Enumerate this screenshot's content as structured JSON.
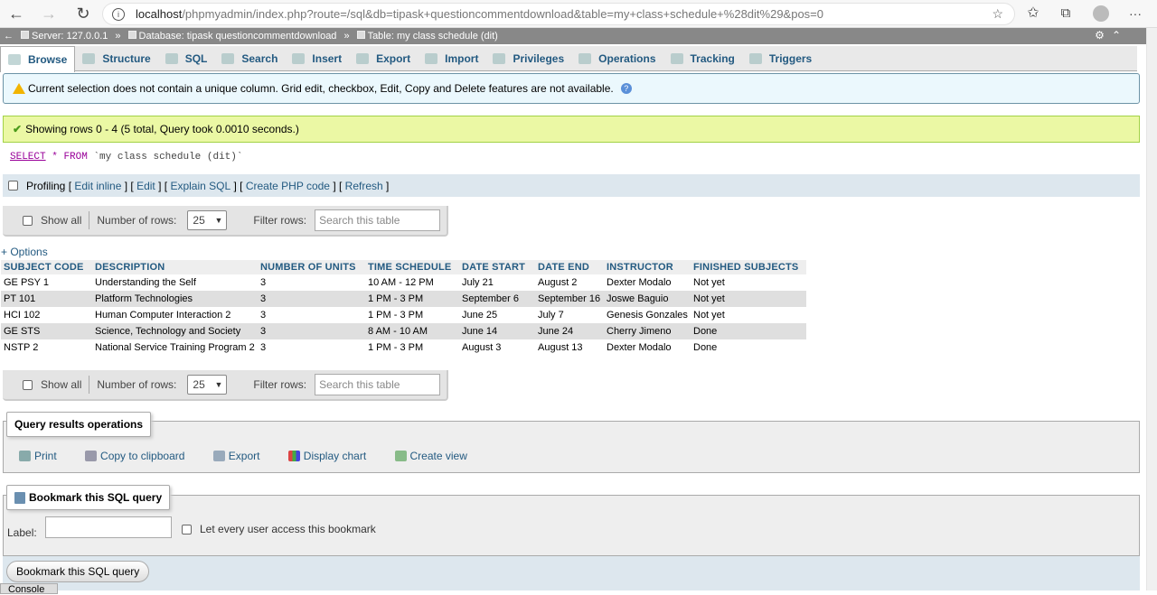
{
  "browser": {
    "url_host": "localhost",
    "url_rest": "/phpmyadmin/index.php?route=/sql&db=tipask+questioncommentdownload&table=my+class+schedule+%28dit%29&pos=0"
  },
  "breadcrumb": {
    "server": "Server: 127.0.0.1",
    "database": "Database: tipask questioncommentdownload",
    "table": "Table: my class schedule (dit)"
  },
  "tabs": [
    {
      "label": "Browse",
      "icon": "browse-icon"
    },
    {
      "label": "Structure",
      "icon": "structure-icon"
    },
    {
      "label": "SQL",
      "icon": "sql-icon"
    },
    {
      "label": "Search",
      "icon": "search-icon"
    },
    {
      "label": "Insert",
      "icon": "insert-icon"
    },
    {
      "label": "Export",
      "icon": "export-icon"
    },
    {
      "label": "Import",
      "icon": "import-icon"
    },
    {
      "label": "Privileges",
      "icon": "privileges-icon"
    },
    {
      "label": "Operations",
      "icon": "operations-icon"
    },
    {
      "label": "Tracking",
      "icon": "tracking-icon"
    },
    {
      "label": "Triggers",
      "icon": "triggers-icon"
    }
  ],
  "notice": "Current selection does not contain a unique column. Grid edit, checkbox, Edit, Copy and Delete features are not available.",
  "success": "Showing rows 0 - 4 (5 total, Query took 0.0010 seconds.)",
  "sql": {
    "select": "SELECT",
    "star": "*",
    "from": "FROM",
    "table": "`my class schedule (dit)`"
  },
  "profiling": {
    "label": "Profiling",
    "edit_inline": "Edit inline",
    "edit": "Edit",
    "explain": "Explain SQL",
    "php": "Create PHP code",
    "refresh": "Refresh"
  },
  "nav": {
    "show_all": "Show all",
    "rows_label": "Number of rows:",
    "rows_value": "25",
    "filter_label": "Filter rows:",
    "filter_placeholder": "Search this table"
  },
  "options_link": "+ Options",
  "table": {
    "headers": [
      "SUBJECT CODE",
      "DESCRIPTION",
      "NUMBER OF UNITS",
      "TIME SCHEDULE",
      "DATE START",
      "DATE END",
      "INSTRUCTOR",
      "FINISHED SUBJECTS"
    ],
    "rows": [
      [
        "GE PSY 1",
        "Understanding the Self",
        "3",
        "10 AM - 12 PM",
        "July 21",
        "August 2",
        "Dexter Modalo",
        "Not yet"
      ],
      [
        "PT 101",
        "Platform Technologies",
        "3",
        "1 PM - 3 PM",
        "September 6",
        "September 16",
        "Joswe Baguio",
        "Not yet"
      ],
      [
        "HCI 102",
        "Human Computer Interaction 2",
        "3",
        "1 PM - 3 PM",
        "June 25",
        "July 7",
        "Genesis Gonzales",
        "Not yet"
      ],
      [
        "GE STS",
        "Science, Technology and Society",
        "3",
        "8 AM - 10 AM",
        "June 14",
        "June 24",
        "Cherry Jimeno",
        "Done"
      ],
      [
        "NSTP 2",
        "National Service Training Program 2",
        "3",
        "1 PM - 3 PM",
        "August 3",
        "August 13",
        "Dexter Modalo",
        "Done"
      ]
    ]
  },
  "query_ops": {
    "legend": "Query results operations",
    "print": "Print",
    "copy": "Copy to clipboard",
    "export": "Export",
    "chart": "Display chart",
    "view": "Create view"
  },
  "bookmark": {
    "legend": "Bookmark this SQL query",
    "label": "Label:",
    "share": "Let every user access this bookmark",
    "button": "Bookmark this SQL query"
  },
  "console": "Console"
}
